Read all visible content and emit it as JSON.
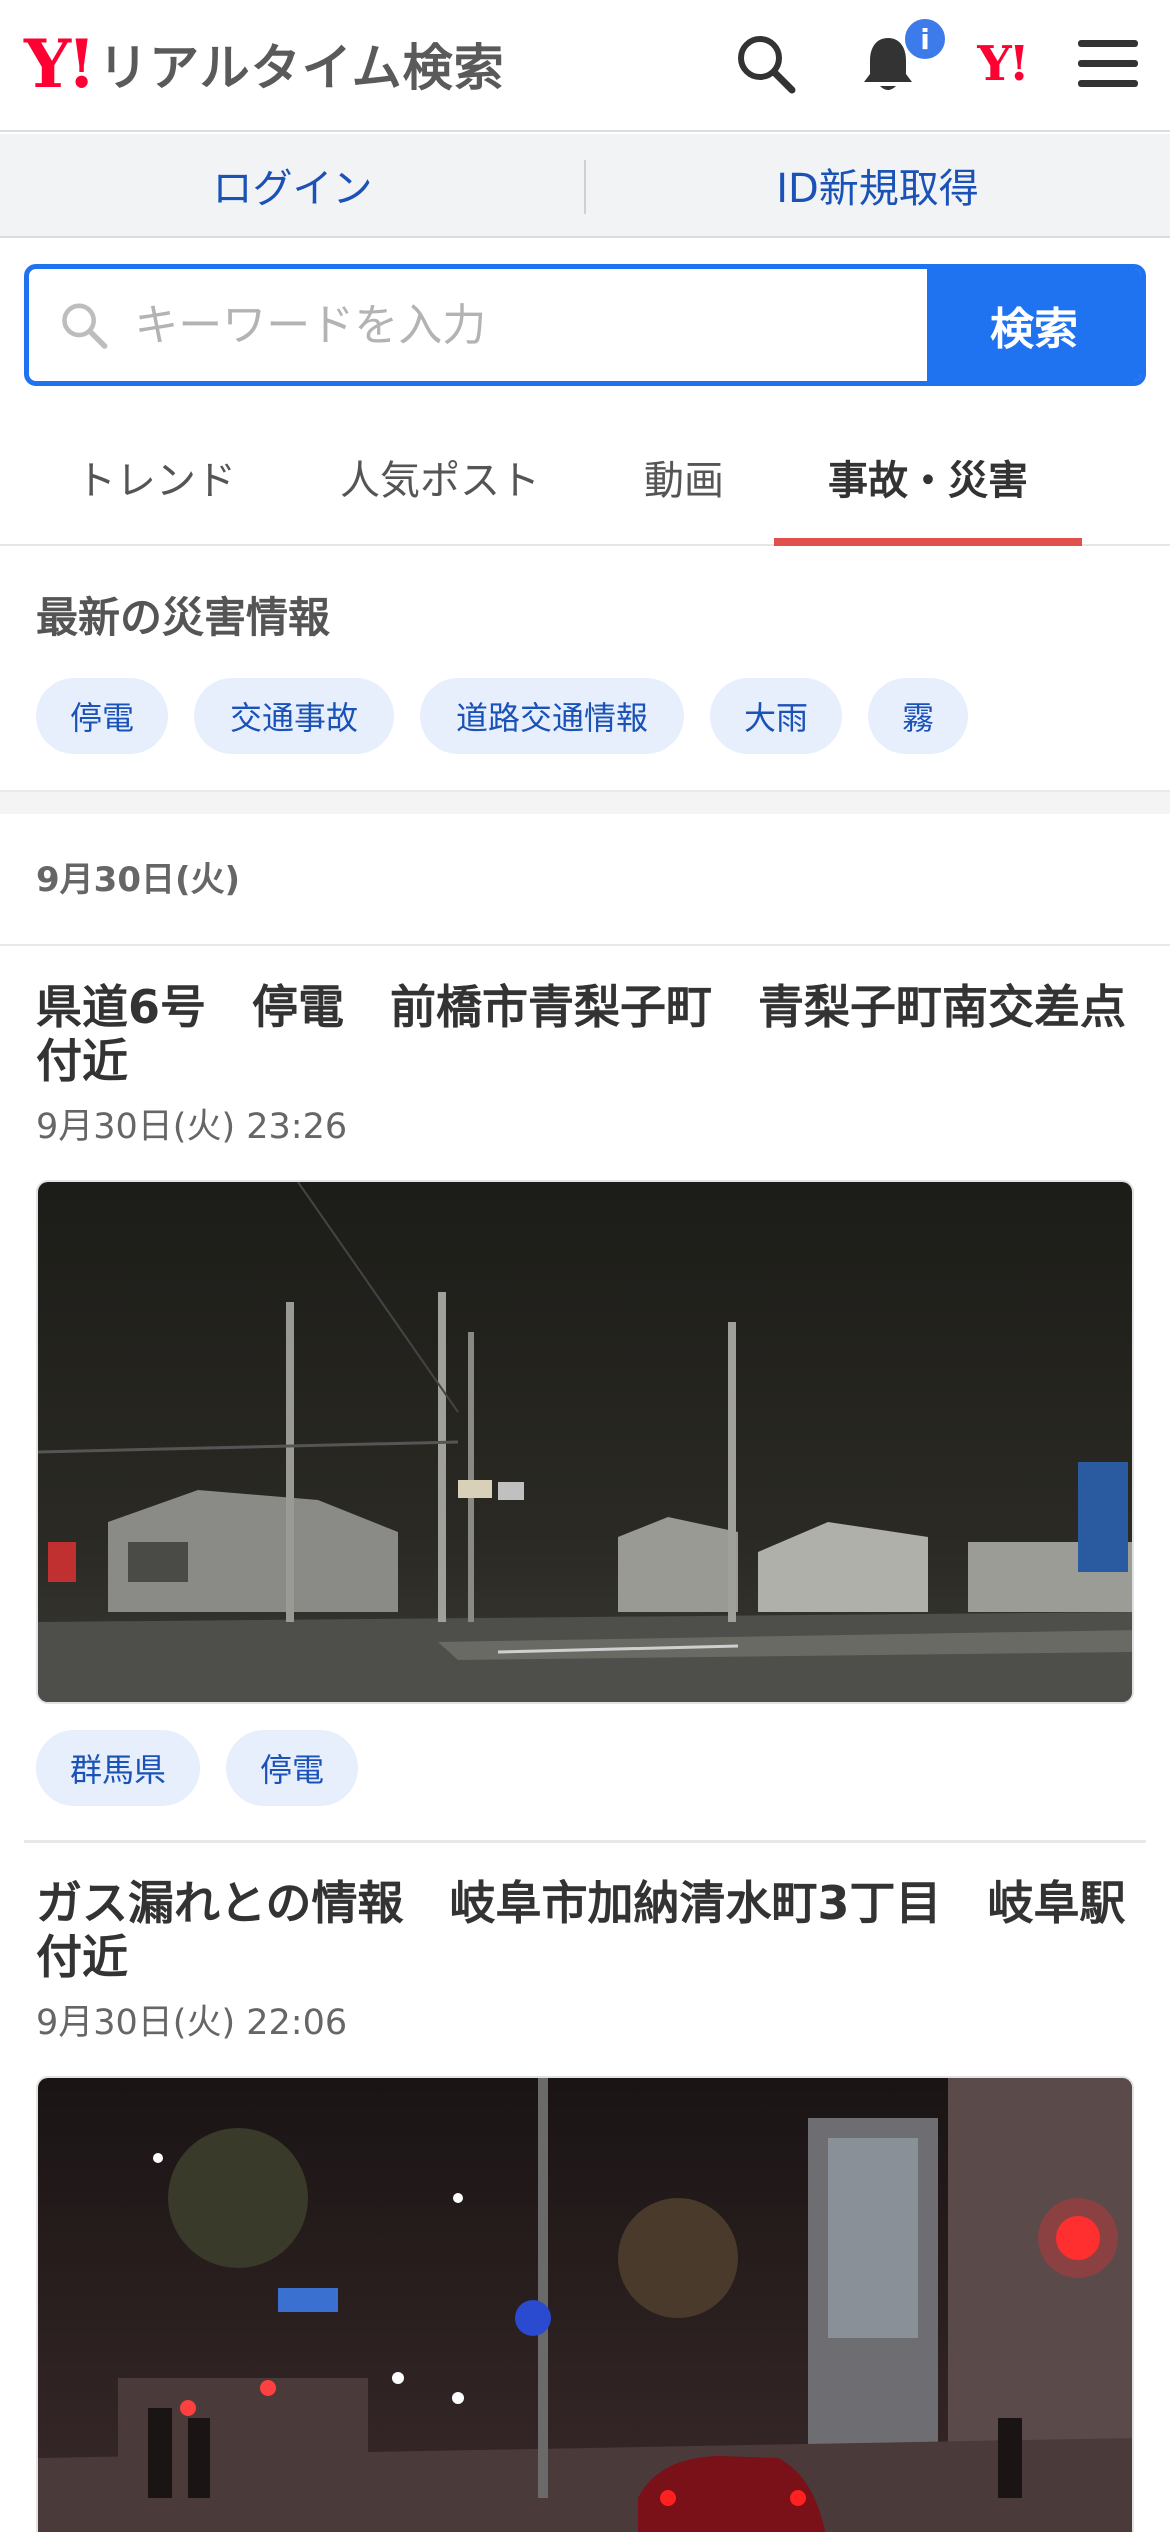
{
  "header": {
    "logo_mark": "Y!",
    "logo_title": "リアルタイム検索",
    "notification_badge": "i",
    "yj_mark": "Y!"
  },
  "account": {
    "login": "ログイン",
    "register": "ID新規取得"
  },
  "search": {
    "placeholder": "キーワードを入力",
    "button": "検索"
  },
  "tabs": [
    {
      "label": "トレンド"
    },
    {
      "label": "人気ポスト"
    },
    {
      "label": "動画"
    },
    {
      "label": "事故・災害",
      "active": true
    }
  ],
  "disaster": {
    "title": "最新の災害情報",
    "chips": [
      "停電",
      "交通事故",
      "道路交通情報",
      "大雨",
      "霧"
    ]
  },
  "date_heading": "9月30日(火)",
  "articles": [
    {
      "title": "県道6号　停電　前橋市青梨子町　青梨子町南交差点付近",
      "time": "9月30日(火) 23:26",
      "tags": [
        "群馬県",
        "停電"
      ]
    },
    {
      "title": "ガス漏れとの情報　岐阜市加納清水町3丁目　岐阜駅付近",
      "time": "9月30日(火) 22:06",
      "tags": []
    }
  ],
  "colors": {
    "brand_red": "#ff0033",
    "accent_blue": "#1f72f0",
    "link_blue": "#1a52b8",
    "active_tab_underline": "#e0504c"
  }
}
